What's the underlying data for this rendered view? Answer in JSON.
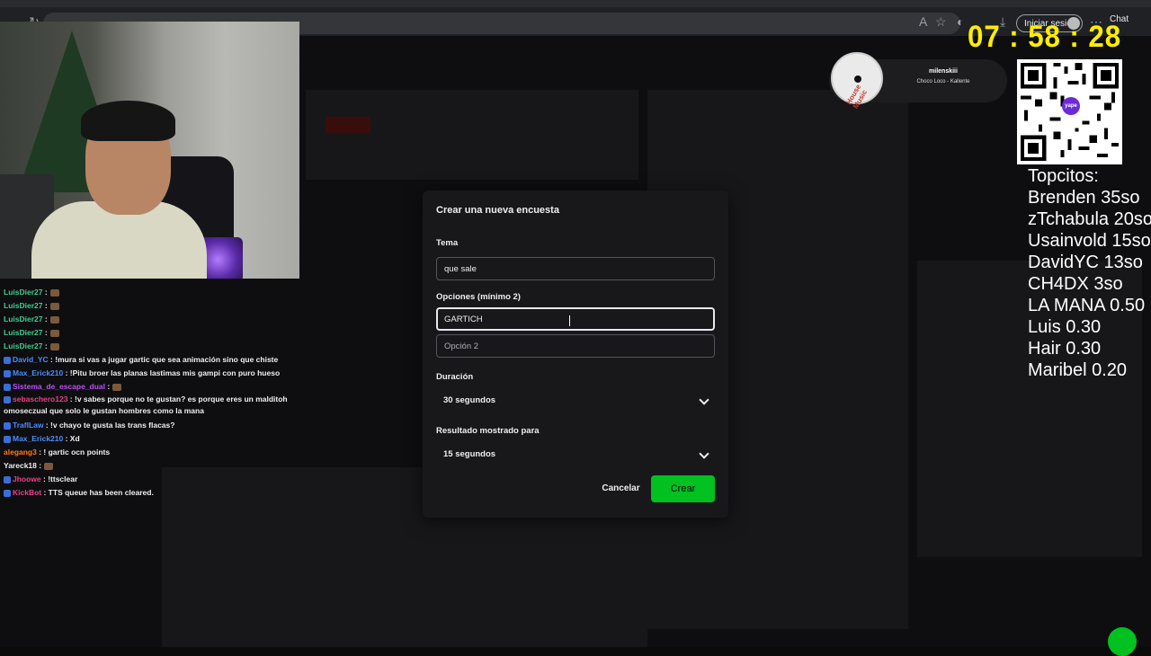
{
  "browser": {
    "signin_label": "Iniciar sesión",
    "chat_label": "Chat"
  },
  "clock": {
    "text": "07 : 58 : 28"
  },
  "music": {
    "user": "milenskiii",
    "song": "Choco Loco - Kallente",
    "disc_text": "House Music"
  },
  "tops": {
    "lines": [
      "Topcitos:",
      "Brenden 35so",
      "zTchabula 20so",
      "Usainvold 15so",
      "DavidYC 13so",
      "CH4DX 3so",
      "LA MANA 0.50",
      "Luis 0.30",
      "Hair 0.30",
      "Maribel 0.20"
    ]
  },
  "chat": {
    "messages": [
      {
        "user": "LuisDier27",
        "color": "#3ccf8f",
        "text": " :"
      },
      {
        "user": "LuisDier27",
        "color": "#3ccf8f",
        "text": " :"
      },
      {
        "user": "LuisDier27",
        "color": "#3ccf8f",
        "text": " :"
      },
      {
        "user": "LuisDier27",
        "color": "#3ccf8f",
        "text": " :"
      },
      {
        "user": "LuisDier27",
        "color": "#3ccf8f",
        "text": " :"
      },
      {
        "user": "David_YC",
        "color": "#4d8cff",
        "text": " : !mura si vas a jugar gartic que sea animación sino que chiste"
      },
      {
        "user": "Max_Erick210",
        "color": "#4d8cff",
        "text": " : !Pitu broer las planas lastimas mis gampi con puro hueso"
      },
      {
        "user": "Sistema_de_escape_dual",
        "color": "#c04dff",
        "text": " :"
      },
      {
        "user": "sebaschero123",
        "color": "#e8418a",
        "text": " : !v sabes porque no te gustan? es porque eres un malditoh omoseczual que solo le gustan hombres como la mana"
      },
      {
        "user": "TraflLaw",
        "color": "#4d8cff",
        "text": " : !v chayo te gusta las trans flacas?"
      },
      {
        "user": "Max_Erick210",
        "color": "#4d8cff",
        "text": " : Xd"
      },
      {
        "user": "alegang3",
        "color": "#ff7a1a",
        "text": " : ! gartic ocn points"
      },
      {
        "user": "Yareck18",
        "color": "#efeff1",
        "text": " :"
      },
      {
        "user": "Jhoowe",
        "color": "#e8418a",
        "text": " : !ttsclear"
      },
      {
        "user": "KickBot",
        "color": "#e8418a",
        "text": " : TTS queue has been cleared."
      }
    ]
  },
  "modal": {
    "title": "Crear una nueva encuesta",
    "topic_label": "Tema",
    "topic_value": "que sale",
    "options_label": "Opciones (mínimo 2)",
    "option1_value": "GARTICH",
    "option2_placeholder": "Opción 2",
    "duration_label": "Duración",
    "duration_value": "30 segundos",
    "result_label": "Resultado mostrado para",
    "result_value": "15 segundos",
    "cancel_label": "Cancelar",
    "create_label": "Crear"
  }
}
